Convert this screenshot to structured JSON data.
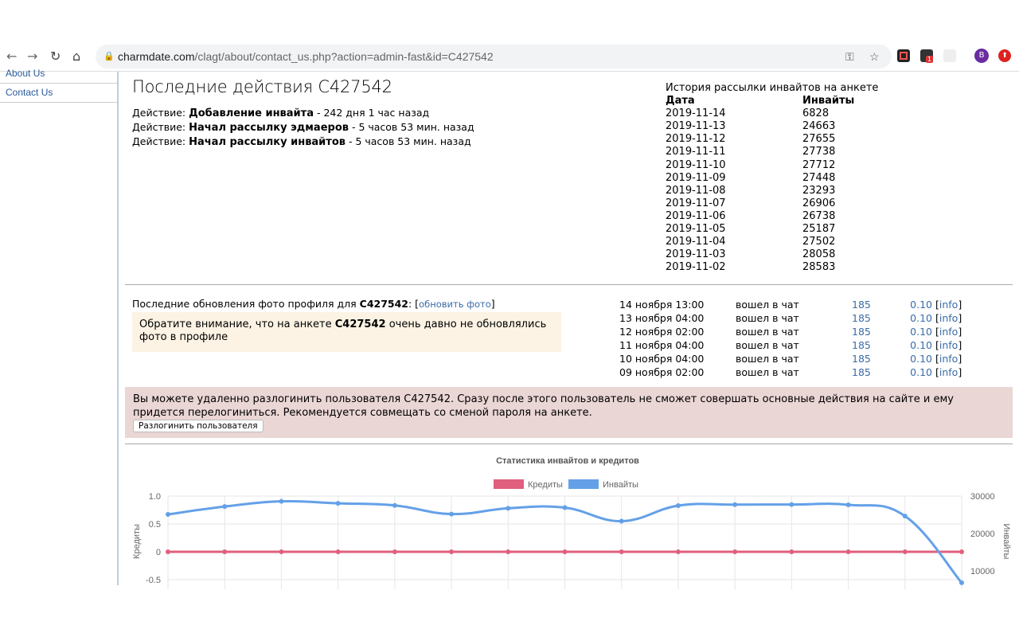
{
  "browser": {
    "url_host": "charmdate.com",
    "url_path": "/clagt/about/contact_us.php?action=admin-fast&id=C427542",
    "profile_initial": "B",
    "extension_badge": "1"
  },
  "sidebar": {
    "items": [
      {
        "label": "About Us"
      },
      {
        "label": "Contact Us"
      }
    ]
  },
  "page": {
    "title": "Последние действия C427542",
    "actions": [
      {
        "prefix": "Действие: ",
        "action": "Добавление инвайта",
        "time": " - 242 дня 1 час назад"
      },
      {
        "prefix": "Действие: ",
        "action": "Начал рассылку эдмаеров",
        "time": " - 5 часов 53 мин. назад"
      },
      {
        "prefix": "Действие: ",
        "action": "Начал рассылку инвайтов",
        "time": " - 5 часов 53 мин. назад"
      }
    ]
  },
  "history": {
    "title": "История рассылки инвайтов на анкете",
    "col_date": "Дата",
    "col_invites": "Инвайты",
    "rows": [
      [
        "2019-11-14",
        "6828"
      ],
      [
        "2019-11-13",
        "24663"
      ],
      [
        "2019-11-12",
        "27655"
      ],
      [
        "2019-11-11",
        "27738"
      ],
      [
        "2019-11-10",
        "27712"
      ],
      [
        "2019-11-09",
        "27448"
      ],
      [
        "2019-11-08",
        "23293"
      ],
      [
        "2019-11-07",
        "26906"
      ],
      [
        "2019-11-06",
        "26738"
      ],
      [
        "2019-11-05",
        "25187"
      ],
      [
        "2019-11-04",
        "27502"
      ],
      [
        "2019-11-03",
        "28058"
      ],
      [
        "2019-11-02",
        "28583"
      ]
    ]
  },
  "photo": {
    "label": "Последние обновления фото профиля для ",
    "id": "C427542",
    "sep": ": [",
    "link": "обновить фото",
    "close": "]",
    "note_pre": "Обратите внимание, что на анкете ",
    "note_id": "C427542",
    "note_post": " очень давно не обновлялись фото в профиле"
  },
  "chat": {
    "rows": [
      [
        "14 ноября 13:00",
        "вошел в чат",
        "185",
        "0.10",
        "info"
      ],
      [
        "13 ноября 04:00",
        "вошел в чат",
        "185",
        "0.10",
        "info"
      ],
      [
        "12 ноября 02:00",
        "вошел в чат",
        "185",
        "0.10",
        "info"
      ],
      [
        "11 ноября 04:00",
        "вошел в чат",
        "185",
        "0.10",
        "info"
      ],
      [
        "10 ноября 04:00",
        "вошел в чат",
        "185",
        "0.10",
        "info"
      ],
      [
        "09 ноября 02:00",
        "вошел в чат",
        "185",
        "0.10",
        "info"
      ]
    ]
  },
  "logout": {
    "text": "Вы можете удаленно разлогинить пользователя C427542. Сразу после этого пользователь не сможет совершать основные действия на сайте и ему придется перелогиниться. Рекомендуется совмещать со сменой пароля на анкете.",
    "button": "Разлогинить пользователя"
  },
  "chart_data": {
    "type": "line",
    "title": "Статистика инвайтов и кредитов",
    "legend_position": "top",
    "grid": true,
    "ylabel_left": "Кредиты",
    "ylabel_right": "Инвайты",
    "y_left_ticks": [
      "1.0",
      "0.5",
      "0",
      "-0.5"
    ],
    "y_right_ticks": [
      "30000",
      "20000",
      "10000"
    ],
    "ylim_left": [
      -0.5,
      1.0
    ],
    "ylim_right": [
      10000,
      30000
    ],
    "series": [
      {
        "name": "Кредиты",
        "color": "#e0607e",
        "axis": "left",
        "values": [
          0,
          0,
          0,
          0,
          0,
          0,
          0,
          0,
          0,
          0,
          0,
          0,
          0,
          0,
          0
        ]
      },
      {
        "name": "Инвайты",
        "color": "#64a0e8",
        "axis": "right",
        "values": [
          25100,
          27200,
          28583,
          28058,
          27502,
          25187,
          26738,
          26906,
          23293,
          27448,
          27712,
          27738,
          27655,
          24663,
          6828
        ]
      }
    ]
  }
}
